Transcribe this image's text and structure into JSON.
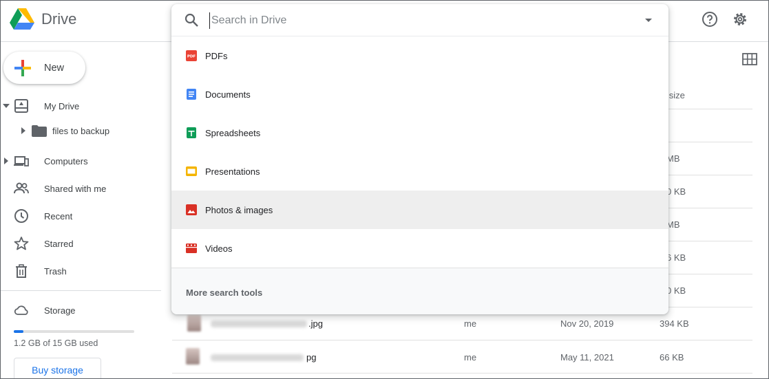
{
  "app": {
    "title": "Drive"
  },
  "header": {
    "help_icon": "help-icon",
    "settings_icon": "gear-icon"
  },
  "sidebar": {
    "new_label": "New",
    "items": [
      {
        "label": "My Drive",
        "icon": "drive-icon"
      },
      {
        "label": "files to backup",
        "icon": "folder-icon"
      },
      {
        "label": "Computers",
        "icon": "computer-icon"
      },
      {
        "label": "Shared with me",
        "icon": "people-icon"
      },
      {
        "label": "Recent",
        "icon": "clock-icon"
      },
      {
        "label": "Starred",
        "icon": "star-icon"
      },
      {
        "label": "Trash",
        "icon": "trash-icon"
      }
    ],
    "storage": {
      "label": "Storage",
      "used_text": "1.2 GB of 15 GB used",
      "used_fraction": 0.08,
      "buy_label": "Buy storage"
    }
  },
  "search": {
    "placeholder": "Search in Drive",
    "options": [
      {
        "label": "PDFs",
        "icon": "pdf-icon",
        "color": "#ea4335"
      },
      {
        "label": "Documents",
        "icon": "document-icon",
        "color": "#4285f4"
      },
      {
        "label": "Spreadsheets",
        "icon": "spreadsheet-icon",
        "color": "#0f9d58"
      },
      {
        "label": "Presentations",
        "icon": "presentation-icon",
        "color": "#f4b400"
      },
      {
        "label": "Photos & images",
        "icon": "image-icon",
        "color": "#d93025"
      },
      {
        "label": "Videos",
        "icon": "video-icon",
        "color": "#d93025"
      }
    ],
    "more_label": "More search tools"
  },
  "file_list": {
    "size_header_partial": "le size",
    "partial_sizes": [
      "MB",
      "0 KB",
      "MB",
      "6 KB",
      "0 KB"
    ],
    "rows": [
      {
        "name_suffix": ".jpg",
        "owner": "me",
        "modified": "Nov 20, 2019",
        "size": "394 KB"
      },
      {
        "name_suffix": "pg",
        "owner": "me",
        "modified": "May 11, 2021",
        "size": "66 KB"
      }
    ]
  }
}
